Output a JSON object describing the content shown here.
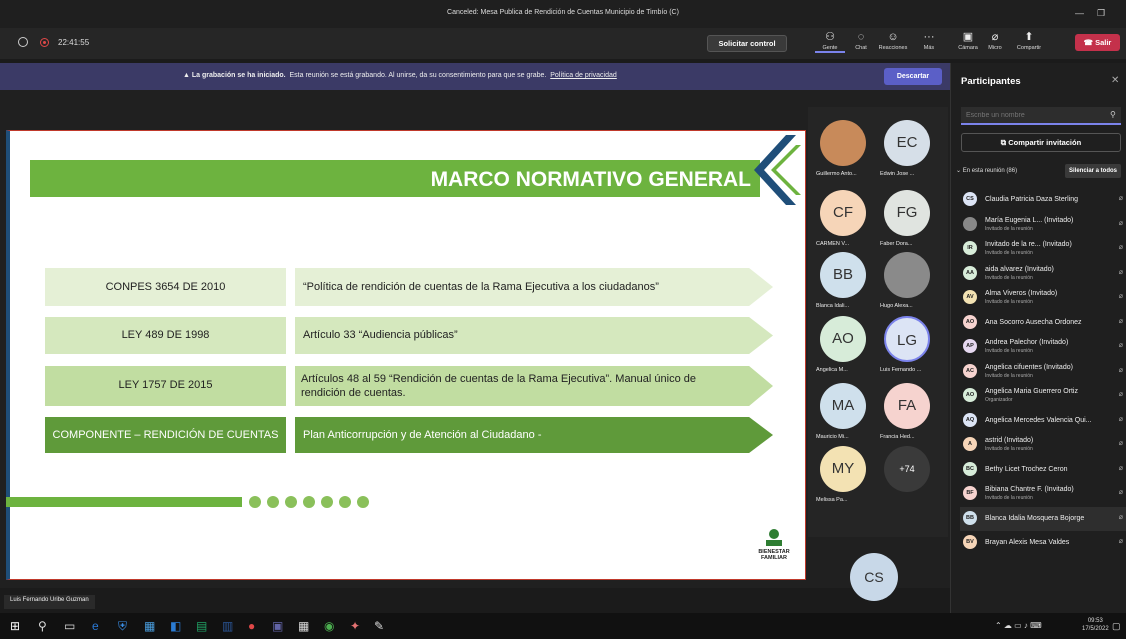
{
  "window": {
    "title": "Canceled: Mesa Publica de Rendición de Cuentas Municipio de Timbío (C)"
  },
  "toolbar": {
    "timer": "22:41:55",
    "control_button": "Solicitar control",
    "items": [
      {
        "label": "Gente",
        "icon": "people-icon"
      },
      {
        "label": "Chat",
        "icon": "chat-icon"
      },
      {
        "label": "Reacciones",
        "icon": "reactions-icon"
      },
      {
        "label": "Más",
        "icon": "more-icon"
      }
    ],
    "media": [
      {
        "label": "Cámara",
        "icon": "camera-off-icon"
      },
      {
        "label": "Micro",
        "icon": "mic-off-icon"
      },
      {
        "label": "Compartir",
        "icon": "share-icon"
      }
    ],
    "leave_button": "Salir"
  },
  "banner": {
    "bold": "La grabación se ha iniciado.",
    "text": "Esta reunión se está grabando. Al unirse, da su consentimiento para que se grabe.",
    "link": "Política de privacidad",
    "dismiss": "Descartar"
  },
  "slide": {
    "title": "MARCO NORMATIVO GENERAL",
    "rows": [
      {
        "label": "CONPES 3654 DE 2010",
        "text": "“Política de rendición de cuentas de la Rama Ejecutiva a los ciudadanos”"
      },
      {
        "label": "LEY 489 DE 1998",
        "text": "Artículo 33 “Audiencia públicas”"
      },
      {
        "label": "LEY 1757 DE 2015",
        "text": "Artículos 48 al 59 “Rendición de cuentas de la Rama Ejecutiva”. Manual único de rendición de cuentas."
      },
      {
        "label": "COMPONENTE – RENDICIÓN DE CUENTAS",
        "text": "Plan Anticorrupción y de Atención al Ciudadano -"
      }
    ],
    "logo_text_1": "BIENESTAR",
    "logo_text_2": "FAMILIAR"
  },
  "presenter_name": "Luis Fernando Uribe Guzman",
  "gallery": [
    {
      "initials": "",
      "name": "Guillermo Anto...",
      "color": "#c88a5a"
    },
    {
      "initials": "EC",
      "name": "Edwin Jose ...",
      "color": "#d6dfe8"
    },
    {
      "initials": "CF",
      "name": "CARMEN V...",
      "color": "#f6d5b8"
    },
    {
      "initials": "FG",
      "name": "Faber Dora...",
      "color": "#e0e4e0"
    },
    {
      "initials": "BB",
      "name": "Blanca Idali...",
      "color": "#cfe0ec"
    },
    {
      "initials": "",
      "name": "Hugo Alexa...",
      "color": "#8a8a8a"
    },
    {
      "initials": "AO",
      "name": "Angelica M...",
      "color": "#d7ecd9"
    },
    {
      "initials": "LG",
      "name": "Luis Fernando ...",
      "color": "#dce4f5"
    },
    {
      "initials": "MA",
      "name": "Mauricio Mi...",
      "color": "#cfe0ec"
    },
    {
      "initials": "FA",
      "name": "Francia Hed...",
      "color": "#f6d3cf"
    },
    {
      "initials": "MY",
      "name": "Melissa Pa...",
      "color": "#f3e2b3"
    },
    {
      "initials": "+74",
      "name": "",
      "color": "#3a3a3a"
    }
  ],
  "self_view": {
    "initials": "CS"
  },
  "participants": {
    "title": "Participantes",
    "search_placeholder": "Escribe un nombre",
    "share_invite": "Compartir invitación",
    "in_meeting": "En esta reunión (86)",
    "mute_all": "Silenciar a todos",
    "list": [
      {
        "initials": "CS",
        "name": "Claudia Patricia Daza Sterling",
        "sub": "",
        "color": "#dce4f5"
      },
      {
        "initials": "",
        "name": "María Eugenia L... (Invitado)",
        "sub": "Invitado de la reunión",
        "color": "#888888"
      },
      {
        "initials": "IR",
        "name": "Invitado de la re... (Invitado)",
        "sub": "Invitado de la reunión",
        "color": "#d7ecd9"
      },
      {
        "initials": "AA",
        "name": "aida alvarez (Invitado)",
        "sub": "Invitado de la reunión",
        "color": "#d7ecd9"
      },
      {
        "initials": "AV",
        "name": "Alma Viveros (Invitado)",
        "sub": "Invitado de la reunión",
        "color": "#f3e2b3"
      },
      {
        "initials": "AO",
        "name": "Ana Socorro Ausecha Ordonez",
        "sub": "",
        "color": "#f6d3cf"
      },
      {
        "initials": "AP",
        "name": "Andrea Palechor (Invitado)",
        "sub": "Invitado de la reunión",
        "color": "#e6d8f0"
      },
      {
        "initials": "AC",
        "name": "Angelica cifuentes (Invitado)",
        "sub": "Invitado de la reunión",
        "color": "#f6d3cf"
      },
      {
        "initials": "AO",
        "name": "Angelica Maria Guerrero Ortiz",
        "sub": "Organizador",
        "color": "#d7ecd9"
      },
      {
        "initials": "AQ",
        "name": "Angelica Mercedes Valencia Qui...",
        "sub": "",
        "color": "#dce4f5"
      },
      {
        "initials": "A",
        "name": "astrid (Invitado)",
        "sub": "Invitado de la reunión",
        "color": "#f6d5b8"
      },
      {
        "initials": "BC",
        "name": "Bethy Licet Trochez Ceron",
        "sub": "",
        "color": "#d7ecd9"
      },
      {
        "initials": "BF",
        "name": "Bibiana Chantre F. (Invitado)",
        "sub": "Invitado de la reunión",
        "color": "#f6d3cf"
      },
      {
        "initials": "BB",
        "name": "Blanca Idalia Mosquera Bojorge",
        "sub": "",
        "color": "#cfe0ec"
      },
      {
        "initials": "BV",
        "name": "Brayan Alexis Mesa Valdes",
        "sub": "",
        "color": "#f6d5b8"
      }
    ]
  },
  "taskbar": {
    "time": "09:53",
    "date": "17/5/2022"
  }
}
